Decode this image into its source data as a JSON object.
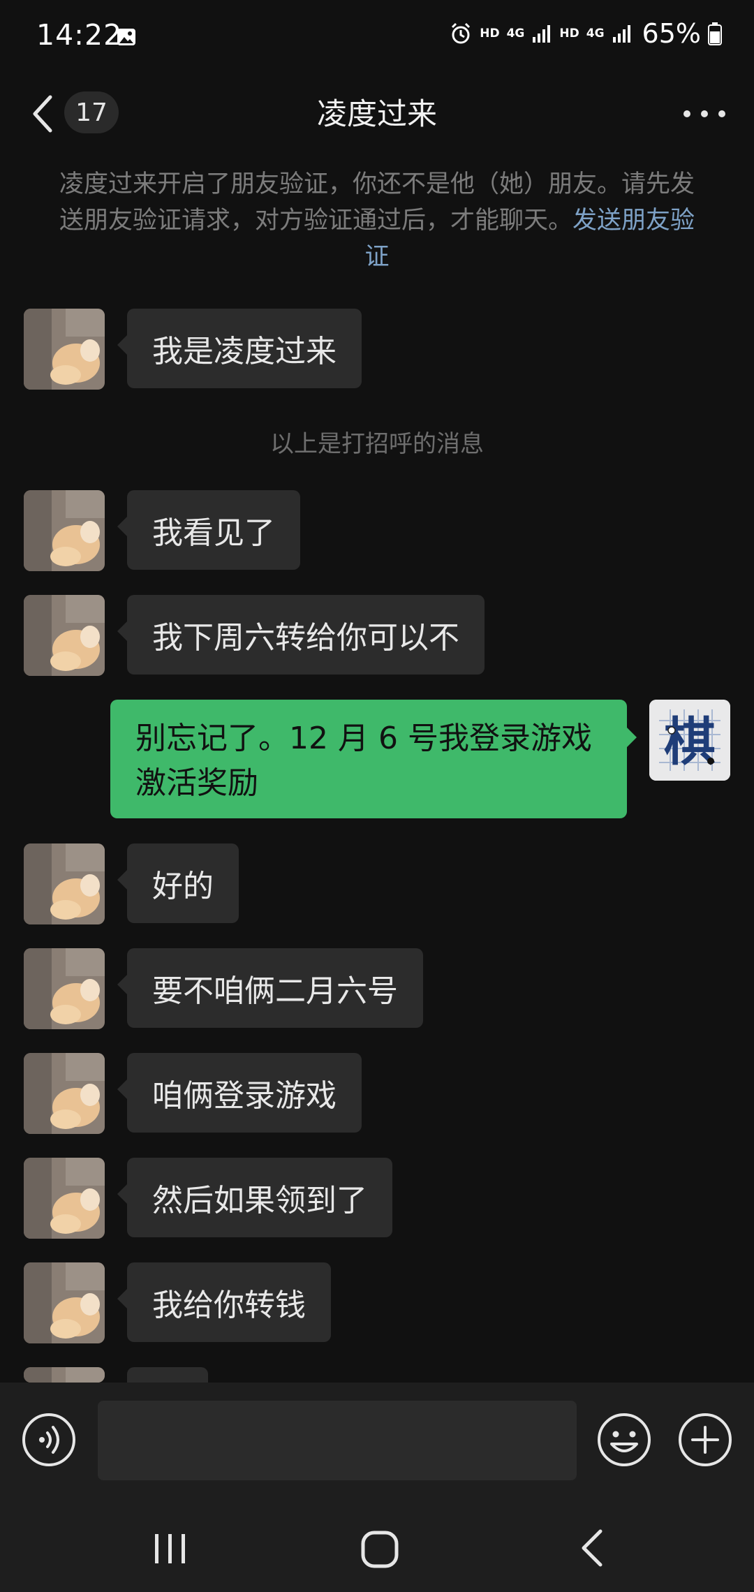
{
  "status_bar": {
    "time": "14:22",
    "hd1": "HD",
    "net1": "4G",
    "hd2": "HD",
    "net2": "4G",
    "battery": "65%"
  },
  "header": {
    "unread_count": "17",
    "title": "凌度过来"
  },
  "notice": {
    "text": "凌度过来开启了朋友验证，你还不是他（她）朋友。请先发送朋友验证请求，对方验证通过后，才能聊天。",
    "link": "发送朋友验证"
  },
  "greeting_hint": "以上是打招呼的消息",
  "messages": [
    {
      "side": "in",
      "text": "我是凌度过来"
    },
    {
      "side": "in",
      "text": "我看见了"
    },
    {
      "side": "in",
      "text": "我下周六转给你可以不"
    },
    {
      "side": "out",
      "text": "别忘记了。12 月 6 号我登录游戏激活奖励"
    },
    {
      "side": "in",
      "text": "好的"
    },
    {
      "side": "in",
      "text": "要不咱俩二月六号"
    },
    {
      "side": "in",
      "text": "咱俩登录游戏"
    },
    {
      "side": "in",
      "text": "然后如果领到了"
    },
    {
      "side": "in",
      "text": "我给你转钱"
    }
  ],
  "my_avatar_glyph": "棋",
  "input": {
    "placeholder": ""
  },
  "colors": {
    "background": "#111111",
    "incoming_bubble": "#2c2c2c",
    "outgoing_bubble": "#3fb96a",
    "link": "#7ea2c7"
  },
  "icons": {
    "back": "chevron-left-icon",
    "more": "more-dots-icon",
    "voice": "voice-icon",
    "emoji": "emoji-icon",
    "plus": "plus-icon"
  }
}
